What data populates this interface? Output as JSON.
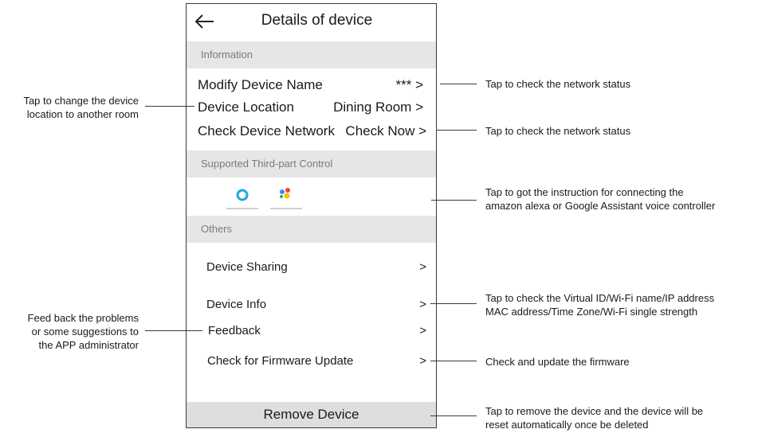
{
  "header": {
    "title": "Details of device",
    "back_icon": "arrow-left-icon"
  },
  "sections": {
    "information": "Information",
    "third_party": "Supported Third-part Control",
    "others": "Others"
  },
  "information_rows": [
    {
      "label": "Modify Device Name",
      "value": "*** >"
    },
    {
      "label": "Device Location",
      "value": "Dining Room >"
    },
    {
      "label": "Check Device Network",
      "value": "Check Now >"
    }
  ],
  "third_party_icons": [
    "amazon-alexa-icon",
    "google-assistant-icon"
  ],
  "others_rows": [
    {
      "label": "Device Sharing",
      "chevron": ">"
    },
    {
      "label": "Device Info",
      "chevron": ">"
    },
    {
      "label": "Feedback",
      "chevron": ">"
    },
    {
      "label": "Check for Firmware Update",
      "chevron": ">"
    }
  ],
  "remove_label": "Remove Device",
  "annotations": {
    "modify_name": "Tap to check the network status",
    "check_network": "Tap to check the network status",
    "third_party_1": "Tap to got the instruction for connecting the",
    "third_party_2": "amazon alexa or Google Assistant voice controller",
    "device_info_1": "Tap to check the Virtual ID/Wi-Fi name/IP address",
    "device_info_2": "MAC address/Time Zone/Wi-Fi single strength",
    "firmware": "Check and update the firmware",
    "remove_1": "Tap to remove the device and the device will be",
    "remove_2": "reset automatically once be deleted",
    "location_1": "Tap to change the device",
    "location_2": "location to another room",
    "feedback_1": "Feed back the problems",
    "feedback_2": "or some suggestions to",
    "feedback_3": "the APP administrator"
  },
  "colors": {
    "section_bg": "#e6e6e6",
    "remove_bg": "#dedede",
    "alexa_blue": "#1fa8e0"
  }
}
